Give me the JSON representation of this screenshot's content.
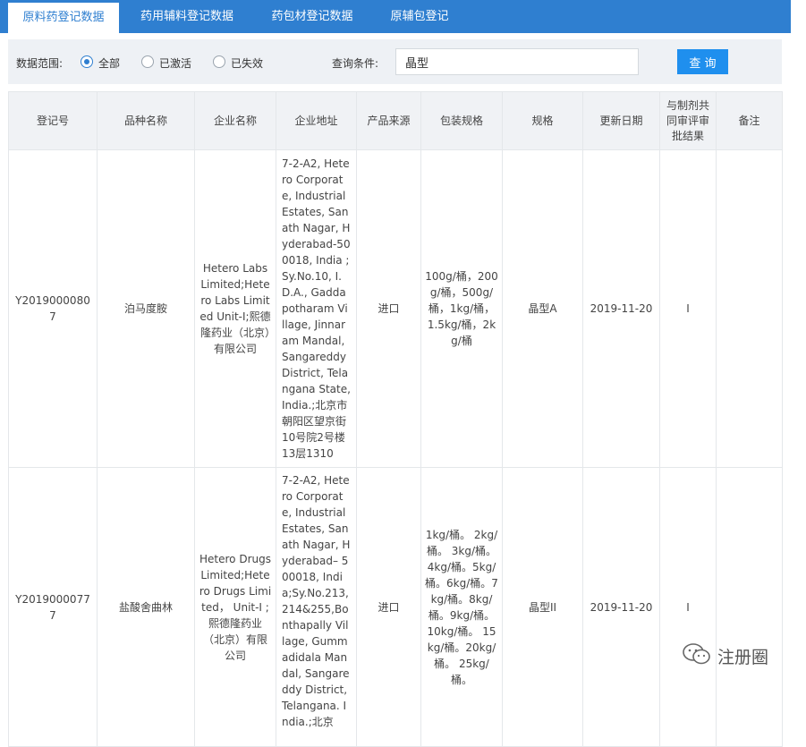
{
  "tabs": [
    {
      "label": "原料药登记数据",
      "active": true
    },
    {
      "label": "药用辅料登记数据",
      "active": false
    },
    {
      "label": "药包材登记数据",
      "active": false
    },
    {
      "label": "原辅包登记",
      "active": false
    }
  ],
  "filter": {
    "range_label": "数据范围:",
    "options": [
      "全部",
      "已激活",
      "已失效"
    ],
    "selected": "全部",
    "query_label": "查询条件:",
    "query_value": "晶型",
    "query_button": "查 询"
  },
  "table": {
    "headers": [
      "登记号",
      "品种名称",
      "企业名称",
      "企业地址",
      "产品来源",
      "包装规格",
      "规格",
      "更新日期",
      "与制剂共同审评审批结果",
      "备注"
    ],
    "rows": [
      {
        "reg_no": "Y20190000807",
        "product": "泊马度胺",
        "company": "Hetero Labs Limited;Hetero Labs Limited Unit-I;熙德隆药业（北京）有限公司",
        "address": "7-2-A2, Hetero Corporate, Industrial Estates, Sanath Nagar, Hyderabad-500018, India ;Sy.No.10, I.D.A., Gaddapotharam Village, Jinnaram Mandal, Sangareddy District, Telangana State, India.;北京市朝阳区望京街10号院2号楼13层1310",
        "source": "进口",
        "packaging": "100g/桶，200g/桶，500g/桶，1kg/桶，1.5kg/桶，2kg/桶",
        "spec": "晶型A",
        "updated": "2019-11-20",
        "review_result": "I",
        "note": ""
      },
      {
        "reg_no": "Y20190000777",
        "product": "盐酸舍曲林",
        "company": "Hetero Drugs Limited;Hetero Drugs Limited， Unit-I ;熙德隆药业（北京）有限公司",
        "address": "7-2-A2, Hetero Corporate, Industrial Estates, Sanath Nagar, Hyderabad– 500018, India;Sy.No.213,214&255,Bonthapally Village, Gummadidala Mandal, Sangareddy District, Telangana. India.;北京",
        "source": "进口",
        "packaging": "1kg/桶。 2kg/桶。 3kg/桶。4kg/桶。5kg/桶。6kg/桶。7kg/桶。8kg/桶。9kg/桶。 10kg/桶。 15kg/桶。20kg/桶。 25kg/桶。",
        "spec": "晶型II",
        "updated": "2019-11-20",
        "review_result": "I",
        "note": ""
      }
    ]
  },
  "watermark": {
    "text": "注册圈",
    "icon": "wechat-icon"
  },
  "colors": {
    "accent": "#2f7fd0",
    "button": "#1f8fee",
    "header_bg": "#f0f2f5",
    "filter_bg": "#eef1f5"
  }
}
